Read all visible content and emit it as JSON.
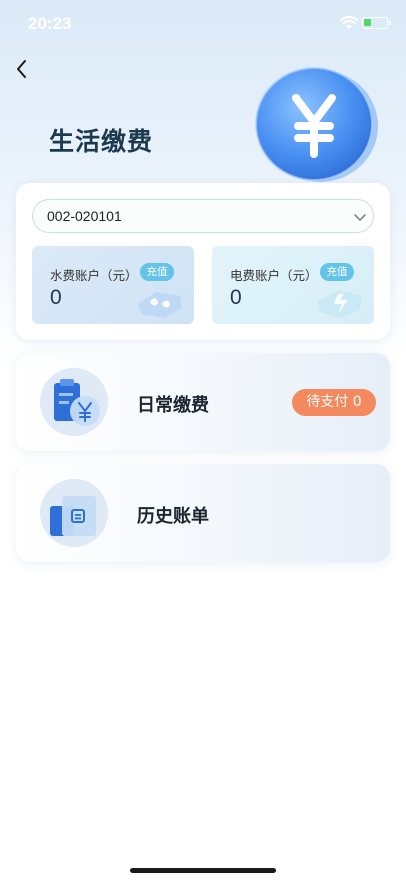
{
  "status_bar": {
    "time": "20:23"
  },
  "header": {
    "title": "生活缴费"
  },
  "account": {
    "selected": "002-020101",
    "water": {
      "label": "水费账户（元）",
      "amount": "0",
      "recharge_label": "充值"
    },
    "power": {
      "label": "电费账户（元）",
      "amount": "0",
      "recharge_label": "充值"
    }
  },
  "menu": {
    "daily": {
      "label": "日常缴费",
      "badge": "待支付 0"
    },
    "history": {
      "label": "历史账单"
    }
  },
  "colors": {
    "accent": "#3b8ef0",
    "badge": "#f3895c",
    "recharge": "#63c3e9",
    "title": "#1c3a4f"
  },
  "icons": [
    "back-icon",
    "coin-icon",
    "chevron-down-icon",
    "water-drop-icon",
    "lightning-icon",
    "bill-icon",
    "history-icon"
  ]
}
